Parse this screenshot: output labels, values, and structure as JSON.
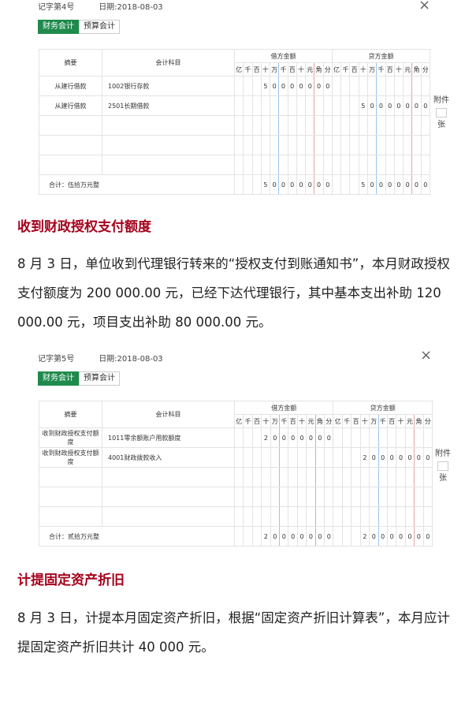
{
  "vouchers": [
    {
      "voucher_no": "记字第4号",
      "date": "日期:2018-08-03",
      "close_icon": "×",
      "tabs": [
        "财务会计",
        "预算会计"
      ],
      "headers": {
        "summary": "摘要",
        "account": "会计科目",
        "debit": "借方金额",
        "credit": "贷方金额"
      },
      "digits": [
        "亿",
        "千",
        "百",
        "十",
        "万",
        "千",
        "百",
        "十",
        "元",
        "角",
        "分"
      ],
      "rows": [
        {
          "summary": "从建行借款",
          "account": "1002银行存款",
          "debit": [
            "",
            "",
            "",
            "5",
            "0",
            "0",
            "0",
            "0",
            "0",
            "0",
            "0"
          ],
          "credit": [
            "",
            "",
            "",
            "",
            "",
            "",
            "",
            "",
            "",
            "",
            ""
          ]
        },
        {
          "summary": "从建行借款",
          "account": "2501长期借款",
          "debit": [
            "",
            "",
            "",
            "",
            "",
            "",
            "",
            "",
            "",
            "",
            ""
          ],
          "credit": [
            "",
            "",
            "",
            "5",
            "0",
            "0",
            "0",
            "0",
            "0",
            "0",
            "0"
          ]
        },
        {
          "summary": "",
          "account": "",
          "debit": [
            "",
            "",
            "",
            "",
            "",
            "",
            "",
            "",
            "",
            "",
            ""
          ],
          "credit": [
            "",
            "",
            "",
            "",
            "",
            "",
            "",
            "",
            "",
            "",
            ""
          ]
        },
        {
          "summary": "",
          "account": "",
          "debit": [
            "",
            "",
            "",
            "",
            "",
            "",
            "",
            "",
            "",
            "",
            ""
          ],
          "credit": [
            "",
            "",
            "",
            "",
            "",
            "",
            "",
            "",
            "",
            "",
            ""
          ]
        },
        {
          "summary": "",
          "account": "",
          "debit": [
            "",
            "",
            "",
            "",
            "",
            "",
            "",
            "",
            "",
            "",
            ""
          ],
          "credit": [
            "",
            "",
            "",
            "",
            "",
            "",
            "",
            "",
            "",
            "",
            ""
          ]
        }
      ],
      "total_label": "合计：伍拾万元整",
      "total_debit": [
        "",
        "",
        "",
        "5",
        "0",
        "0",
        "0",
        "0",
        "0",
        "0",
        "0"
      ],
      "total_credit": [
        "",
        "",
        "",
        "5",
        "0",
        "0",
        "0",
        "0",
        "0",
        "0",
        "0"
      ],
      "attach_label": "附件",
      "attach_unit": "张"
    },
    {
      "voucher_no": "记字第5号",
      "date": "日期:2018-08-03",
      "close_icon": "×",
      "tabs": [
        "财务会计",
        "预算会计"
      ],
      "headers": {
        "summary": "摘要",
        "account": "会计科目",
        "debit": "借方金额",
        "credit": "贷方金额"
      },
      "digits": [
        "亿",
        "千",
        "百",
        "十",
        "万",
        "千",
        "百",
        "十",
        "元",
        "角",
        "分"
      ],
      "rows": [
        {
          "summary": "收到财政授权支付额度",
          "account": "1011零余额账户用款额度",
          "debit": [
            "",
            "",
            "",
            "2",
            "0",
            "0",
            "0",
            "0",
            "0",
            "0",
            "0"
          ],
          "credit": [
            "",
            "",
            "",
            "",
            "",
            "",
            "",
            "",
            "",
            "",
            ""
          ]
        },
        {
          "summary": "收到财政授权支付额度",
          "account": "4001财政拨款收入",
          "debit": [
            "",
            "",
            "",
            "",
            "",
            "",
            "",
            "",
            "",
            "",
            ""
          ],
          "credit": [
            "",
            "",
            "",
            "2",
            "0",
            "0",
            "0",
            "0",
            "0",
            "0",
            "0"
          ]
        },
        {
          "summary": "",
          "account": "",
          "debit": [
            "",
            "",
            "",
            "",
            "",
            "",
            "",
            "",
            "",
            "",
            ""
          ],
          "credit": [
            "",
            "",
            "",
            "",
            "",
            "",
            "",
            "",
            "",
            "",
            ""
          ]
        },
        {
          "summary": "",
          "account": "",
          "debit": [
            "",
            "",
            "",
            "",
            "",
            "",
            "",
            "",
            "",
            "",
            ""
          ],
          "credit": [
            "",
            "",
            "",
            "",
            "",
            "",
            "",
            "",
            "",
            "",
            ""
          ]
        },
        {
          "summary": "",
          "account": "",
          "debit": [
            "",
            "",
            "",
            "",
            "",
            "",
            "",
            "",
            "",
            "",
            ""
          ],
          "credit": [
            "",
            "",
            "",
            "",
            "",
            "",
            "",
            "",
            "",
            "",
            ""
          ]
        }
      ],
      "total_label": "合计：贰拾万元整",
      "total_debit": [
        "",
        "",
        "",
        "2",
        "0",
        "0",
        "0",
        "0",
        "0",
        "0",
        "0"
      ],
      "total_credit": [
        "",
        "",
        "",
        "2",
        "0",
        "0",
        "0",
        "0",
        "0",
        "0",
        "0"
      ],
      "attach_label": "附件",
      "attach_unit": "张"
    }
  ],
  "sections": [
    {
      "heading": "收到财政授权支付额度",
      "paragraph": "8 月 3 日，单位收到代理银行转来的“授权支付到账通知书”，本月财政授权支付额度为 200 000.00 元，已经下达代理银行，其中基本支出补助 120 000.00 元，项目支出补助 80 000.00 元。"
    },
    {
      "heading": "计提固定资产折旧",
      "paragraph": "8 月 3 日，计提本月固定资产折旧，根据“固定资产折旧计算表”，本月应计提固定资产折旧共计 40 000 元。"
    }
  ]
}
